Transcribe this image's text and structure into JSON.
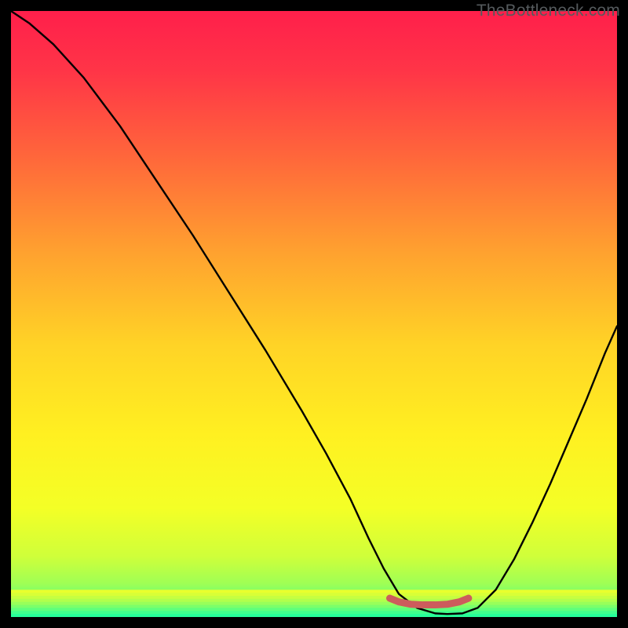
{
  "watermark": "TheBottleneck.com",
  "chart_data": {
    "type": "line",
    "title": "",
    "xlabel": "",
    "ylabel": "",
    "xlim": [
      0,
      100
    ],
    "ylim": [
      0,
      100
    ],
    "grid": false,
    "legend": false,
    "series": [
      {
        "name": "curve",
        "color": "#000000",
        "x": [
          0,
          3,
          7,
          12,
          18,
          24,
          30,
          36,
          42,
          48,
          52,
          56,
          59,
          61.5,
          64,
          67,
          70,
          72,
          74.5,
          77,
          80,
          83,
          86,
          89,
          92,
          95,
          98,
          100
        ],
        "y": [
          100,
          98,
          94.5,
          89,
          81,
          72,
          63,
          53.5,
          44,
          34,
          27,
          19.5,
          13,
          8,
          3.8,
          1.5,
          0.6,
          0.5,
          0.6,
          1.5,
          4.5,
          9.5,
          15.5,
          22,
          29,
          36,
          43.5,
          48
        ]
      },
      {
        "name": "bottleneck-band",
        "color": "#cd5c5c",
        "x": [
          62.5,
          64,
          66,
          68,
          70,
          72,
          74,
          75.5
        ],
        "y": [
          3.1,
          2.5,
          2.1,
          2.0,
          2.0,
          2.1,
          2.5,
          3.1
        ]
      }
    ],
    "background_gradient": {
      "stops": [
        {
          "offset": 0.0,
          "color": "#ff1f4b"
        },
        {
          "offset": 0.1,
          "color": "#ff3547"
        },
        {
          "offset": 0.25,
          "color": "#ff6a3a"
        },
        {
          "offset": 0.4,
          "color": "#ffa22f"
        },
        {
          "offset": 0.55,
          "color": "#ffd326"
        },
        {
          "offset": 0.7,
          "color": "#fff021"
        },
        {
          "offset": 0.82,
          "color": "#f4ff26"
        },
        {
          "offset": 0.9,
          "color": "#cfff3a"
        },
        {
          "offset": 0.945,
          "color": "#9fff55"
        },
        {
          "offset": 0.975,
          "color": "#5dff7a"
        },
        {
          "offset": 1.0,
          "color": "#23ff98"
        }
      ]
    },
    "bottom_stripes": [
      {
        "y": 0.955,
        "color": "#e8ff2e"
      },
      {
        "y": 0.96,
        "color": "#d9ff36"
      },
      {
        "y": 0.965,
        "color": "#c7ff40"
      },
      {
        "y": 0.97,
        "color": "#b2ff4c"
      },
      {
        "y": 0.975,
        "color": "#99ff5a"
      },
      {
        "y": 0.98,
        "color": "#7cff6a"
      },
      {
        "y": 0.985,
        "color": "#5eff7c"
      },
      {
        "y": 0.99,
        "color": "#40ff8d"
      },
      {
        "y": 0.995,
        "color": "#27ff99"
      }
    ]
  }
}
